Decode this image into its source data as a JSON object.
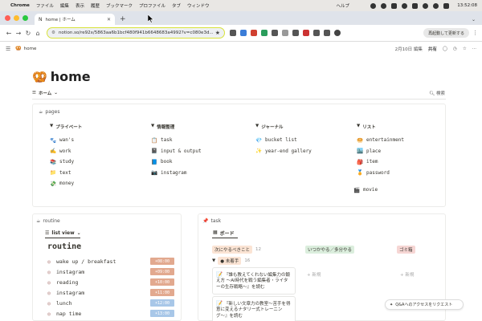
{
  "menubar": {
    "app": "Chrome",
    "items": [
      "ファイル",
      "編集",
      "表示",
      "履歴",
      "ブックマーク",
      "プロファイル",
      "タブ",
      "ウィンドウ"
    ],
    "help": "ヘルプ",
    "clock": "13:52:08"
  },
  "tabstrip": {
    "tab_title": "home | ホーム",
    "new_tab": "+"
  },
  "toolbar": {
    "url": "notion.so/re92x/5863aa6b1bcf480f941b6648683a4992?v=c080e3d...",
    "relaunch": "再起動して更新する"
  },
  "notion_top": {
    "breadcrumb": "home",
    "edited": "2月10日 編集",
    "share": "共有"
  },
  "page": {
    "title": "home",
    "title_emoji": "🥨",
    "nav_home": "ホーム",
    "search": "検索"
  },
  "pages": {
    "heading": "pages",
    "columns": [
      {
        "head": "プライベート",
        "items": [
          {
            "icon": "🐾",
            "label": "wan's"
          },
          {
            "icon": "✍️",
            "label": "work"
          },
          {
            "icon": "📚",
            "label": "study"
          },
          {
            "icon": "📁",
            "label": "text"
          },
          {
            "icon": "💸",
            "label": "money"
          }
        ]
      },
      {
        "head": "情報整理",
        "items": [
          {
            "icon": "📋",
            "label": "task"
          },
          {
            "icon": "📓",
            "label": "input & output"
          },
          {
            "icon": "📘",
            "label": "book"
          },
          {
            "icon": "📷",
            "label": "instagram"
          }
        ]
      },
      {
        "head": "ジャーナル",
        "items": [
          {
            "icon": "💎",
            "label": "bucket list"
          },
          {
            "icon": "✨",
            "label": "year-end gallery"
          }
        ]
      },
      {
        "head": "リスト",
        "items": [
          {
            "icon": "🥯",
            "label": "entertainment"
          },
          {
            "icon": "🏙️",
            "label": "place"
          },
          {
            "icon": "🎒",
            "label": "item"
          },
          {
            "icon": "🏅",
            "label": "password"
          }
        ]
      }
    ],
    "extra": {
      "icon": "🎬",
      "label": "movie"
    }
  },
  "routine": {
    "heading": "routine",
    "view": "list view",
    "title": "routine",
    "rows": [
      {
        "label": "wake up / breakfast",
        "time": "08:00",
        "color": "#e2a98f"
      },
      {
        "label": "instagram",
        "time": "09:00",
        "color": "#e2a98f"
      },
      {
        "label": "reading",
        "time": "10:00",
        "color": "#e2a98f"
      },
      {
        "label": "instagram",
        "time": "11:00",
        "color": "#e2a98f"
      },
      {
        "label": "lunch",
        "time": "12:00",
        "color": "#a8c7e8"
      },
      {
        "label": "nap time",
        "time": "13:00",
        "color": "#a8c7e8"
      }
    ]
  },
  "task": {
    "heading": "task",
    "view": "ボード",
    "columns": [
      {
        "label": "次にやるべきこと",
        "count": "12",
        "bg": "#fbe4d4"
      },
      {
        "label": "いつかやる／多分やる",
        "count": "",
        "bg": "#dbeedd"
      },
      {
        "label": "ゴミ箱",
        "count": "",
        "bg": "#f6d6d4"
      }
    ],
    "group": {
      "label": "未着手",
      "count": "16"
    },
    "cards": [
      {
        "icon": "📝",
        "text": "『誰も教えてくれない編集力の鍛え方 〜AI時代を戦う編集者・ライターの生存戦略〜』を読む"
      },
      {
        "icon": "📝",
        "text": "『新しい文章力の教室〜苦手を得意に変えるナタリー式トレーニング〜』を読む"
      }
    ],
    "add_new": "+ 新規",
    "qa": "Q&Aへのアクセスをリクエスト"
  }
}
